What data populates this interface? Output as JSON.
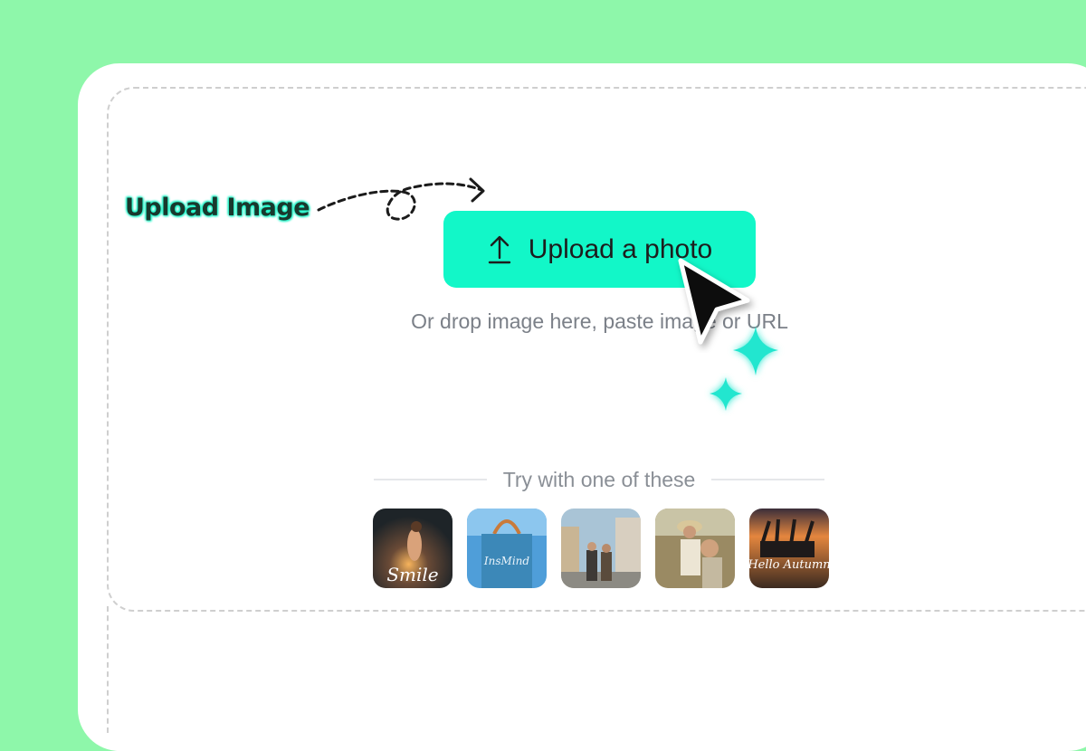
{
  "callout": {
    "label": "Upload Image"
  },
  "upload": {
    "button_label": "Upload a photo",
    "icon": "upload-arrow-icon",
    "hint": "Or drop image here, paste image or URL"
  },
  "samples": {
    "heading": "Try with one of these",
    "items": [
      {
        "name": "sample-smile",
        "overlay_text": "Smile"
      },
      {
        "name": "sample-tote-bag",
        "overlay_text": "InsMind"
      },
      {
        "name": "sample-street-couple",
        "overlay_text": ""
      },
      {
        "name": "sample-field-portrait",
        "overlay_text": ""
      },
      {
        "name": "sample-hello-autumn",
        "overlay_text": "Hello Autumn"
      }
    ]
  },
  "colors": {
    "background": "#8ef7aa",
    "accent": "#12f7c8",
    "card": "#ffffff",
    "hint_text": "#7b8088"
  },
  "icons": [
    "upload-arrow-icon",
    "mouse-pointer-icon",
    "sparkle-icon"
  ]
}
